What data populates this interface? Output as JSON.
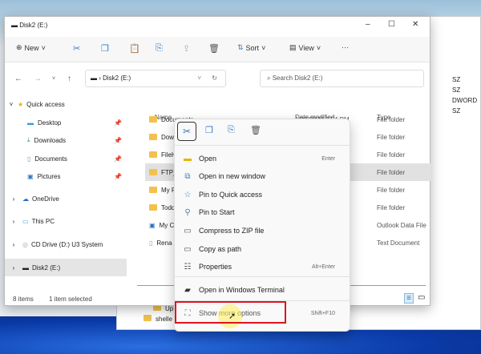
{
  "window": {
    "title": "Disk2 (E:)",
    "minimize": "–",
    "maximize": "☐",
    "close": "✕"
  },
  "toolbar": {
    "new": "New",
    "sort": "Sort",
    "view": "View",
    "more": "···"
  },
  "address": {
    "path": "Disk2 (E:)",
    "search_placeholder": "Search Disk2 (E:)"
  },
  "nav": {
    "items": [
      {
        "label": "Quick access",
        "icon": "star-icon"
      },
      {
        "label": "Desktop",
        "icon": "desktop-icon"
      },
      {
        "label": "Downloads",
        "icon": "download-icon"
      },
      {
        "label": "Documents",
        "icon": "document-icon"
      },
      {
        "label": "Pictures",
        "icon": "pictures-icon"
      },
      {
        "label": "OneDrive",
        "icon": "cloud-icon"
      },
      {
        "label": "This PC",
        "icon": "pc-icon"
      },
      {
        "label": "CD Drive (D:) U3 System",
        "icon": "cd-icon"
      },
      {
        "label": "Disk2 (E:)",
        "icon": "drive-icon"
      }
    ]
  },
  "columns": {
    "name": "Name",
    "date": "Date modified",
    "type": "Type"
  },
  "files": [
    {
      "name": "Documents",
      "date": "1/23/2022 7:54 PM",
      "type": "File folder"
    },
    {
      "name": "Dow",
      "type": "File folder"
    },
    {
      "name": "FileH",
      "type": "File folder"
    },
    {
      "name": "FTP_",
      "type": "File folder"
    },
    {
      "name": "My F",
      "type": "File folder"
    },
    {
      "name": "Todd",
      "type": "File folder"
    },
    {
      "name": "My C",
      "type": "Outlook Data File"
    },
    {
      "name": "Rena",
      "type": "Text Document"
    }
  ],
  "status": {
    "count": "8 items",
    "selected": "1 item selected"
  },
  "context_menu": {
    "items": [
      {
        "label": "Open",
        "shortcut": "Enter"
      },
      {
        "label": "Open in new window",
        "shortcut": ""
      },
      {
        "label": "Pin to Quick access",
        "shortcut": ""
      },
      {
        "label": "Pin to Start",
        "shortcut": ""
      },
      {
        "label": "Compress to ZIP file",
        "shortcut": ""
      },
      {
        "label": "Copy as path",
        "shortcut": ""
      },
      {
        "label": "Properties",
        "shortcut": "Alt+Enter"
      },
      {
        "label": "Open in Windows Terminal",
        "shortcut": ""
      },
      {
        "label": "Show more options",
        "shortcut": "Shift+F10"
      }
    ]
  },
  "background_window": {
    "values": [
      "SZ",
      "SZ",
      "DWORD",
      "SZ"
    ],
    "tree": [
      "Up",
      "shelle"
    ]
  },
  "colors": {
    "highlight": "#e0141e",
    "accent": "#2f78c4"
  }
}
